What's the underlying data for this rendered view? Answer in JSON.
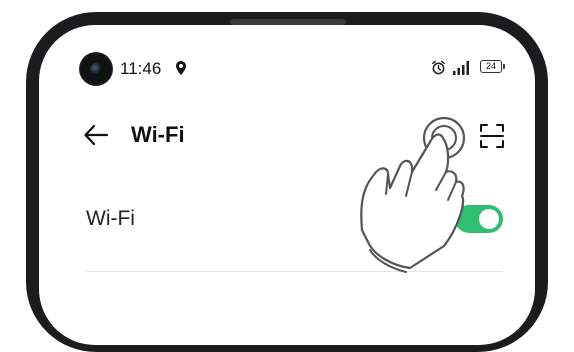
{
  "status_bar": {
    "time": "11:46",
    "battery_level": "24",
    "icons": [
      "location-pin-icon",
      "alarm-clock-icon",
      "signal-bars-icon",
      "battery-icon"
    ]
  },
  "header": {
    "title": "Wi-Fi",
    "back_icon": "arrow-left-icon",
    "action_icon": "more-options-icon",
    "scan_icon": "scan-qr-icon"
  },
  "wifi_setting": {
    "label": "Wi-Fi",
    "enabled": true
  },
  "overlay": {
    "gesture_icon": "tap-hand-icon"
  },
  "colors": {
    "toggle_on": "#2fbf71",
    "frame": "#1c1c1e",
    "text": "#111111"
  }
}
